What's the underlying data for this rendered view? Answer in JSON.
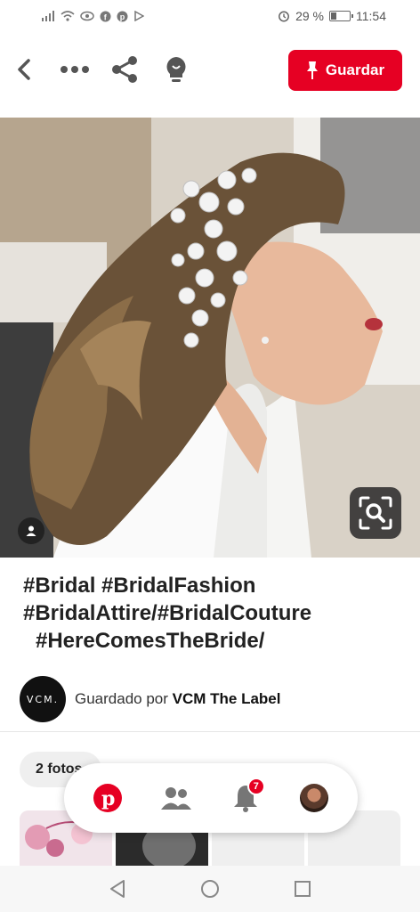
{
  "status_bar": {
    "left_icons": [
      "signal-icon",
      "wifi-icon",
      "eye-icon",
      "facebook-icon",
      "pinterest-icon",
      "play-icon"
    ],
    "battery_percent": "29 %",
    "battery_level": 0.29,
    "time": "11:54"
  },
  "toolbar": {
    "save_label": "Guardar",
    "accent_color": "#e60023",
    "icons": [
      "back-arrow-icon",
      "more-options-icon",
      "share-icon",
      "lightbulb-icon"
    ]
  },
  "pin": {
    "image_alt": "bride-hair-accessory-photo",
    "lens_icon": "visual-search-icon",
    "creator_icon": "person-icon"
  },
  "description": {
    "line1": "#Bridal   #BridalFashion",
    "line2": "#BridalAttire/#BridalCouture",
    "line3": "#HereComesTheBride/"
  },
  "saved_by": {
    "avatar_text": "VCM.",
    "prefix": "Guardado por ",
    "name": "VCM The Label"
  },
  "photos": {
    "chip_label": "2 fotos"
  },
  "bottom_nav": {
    "notifications_count": "7",
    "items": [
      "home-pinterest-icon",
      "following-people-icon",
      "notifications-bell-icon",
      "profile-avatar"
    ]
  },
  "android_nav": [
    "back-triangle-icon",
    "home-circle-icon",
    "recents-square-icon"
  ]
}
